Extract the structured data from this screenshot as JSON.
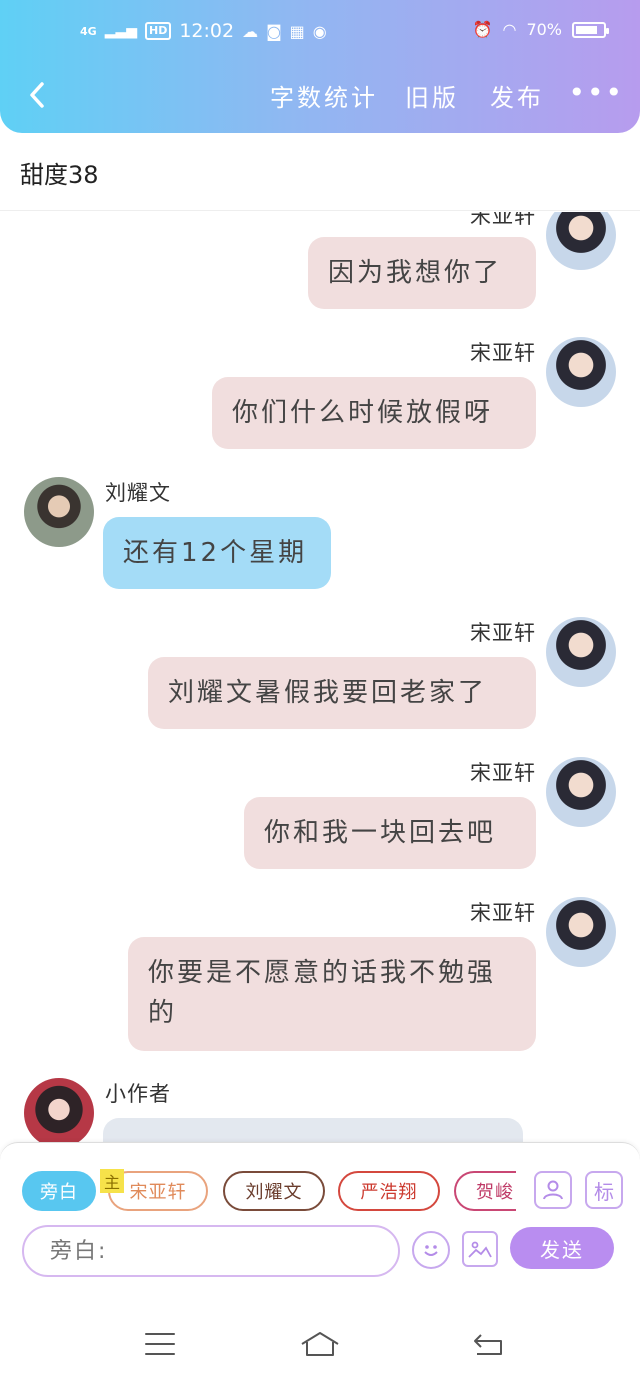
{
  "status_bar": {
    "network": "4G",
    "hd": "HD",
    "time": "12:02",
    "battery": "70%",
    "battery_level": 0.7
  },
  "nav": {
    "word_count": "字数统计",
    "old_version": "旧版",
    "publish": "发布",
    "more": "•••"
  },
  "story": {
    "title": "甜度38"
  },
  "messages": [
    {
      "sender": "宋亚轩",
      "text": "因为我想你了",
      "side": "right",
      "style": "pink"
    },
    {
      "sender": "宋亚轩",
      "text": "你们什么时候放假呀",
      "side": "right",
      "style": "pink"
    },
    {
      "sender": "刘耀文",
      "text": "还有12个星期",
      "side": "left",
      "style": "blue"
    },
    {
      "sender": "宋亚轩",
      "text": "刘耀文暑假我要回老家了",
      "side": "right",
      "style": "pink"
    },
    {
      "sender": "宋亚轩",
      "text": "你和我一块回去吧",
      "side": "right",
      "style": "pink"
    },
    {
      "sender": "宋亚轩",
      "text": "你要是不愿意的话我不勉强的",
      "side": "right",
      "style": "pink"
    },
    {
      "sender": "小作者",
      "text": "",
      "side": "left",
      "style": "gray"
    }
  ],
  "composer": {
    "chips": [
      "旁白",
      "宋亚轩",
      "刘耀文",
      "严浩翔",
      "贺峻"
    ],
    "main_tag": "主",
    "contacts_icon": "person-icon",
    "tag_label": "标",
    "input_placeholder": "旁白:",
    "emoji_icon": "smiley-icon",
    "image_icon": "image-icon",
    "send": "发送"
  },
  "colors": {
    "header_start": "#5fd0f5",
    "header_end": "#b79cee",
    "bubble_pink": "#f1dede",
    "bubble_blue": "#a4dcf7",
    "send": "#b98df0"
  }
}
